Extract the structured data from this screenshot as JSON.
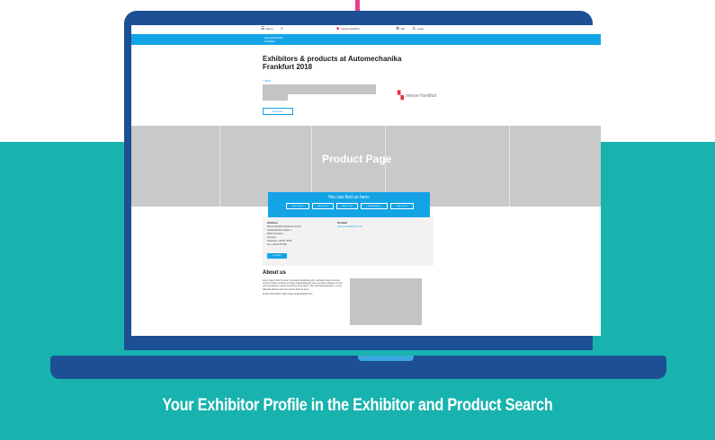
{
  "colors": {
    "teal": "#18b3ae",
    "laptop_blue": "#1d4f95",
    "site_blue": "#14a4e6",
    "placeholder_gray": "#c4c4c4",
    "logo_red": "#e5303f",
    "cord_pink": "#e83c8e"
  },
  "topbar": {
    "menu_label": "Menu",
    "search_icon": "search-icon",
    "center_text": "messe frankfurt",
    "lang_label": "EN",
    "login_label": "Login"
  },
  "brandbar": {
    "line1": "automechanika",
    "line2": "Frankfurt"
  },
  "page": {
    "title": "Exhibitors & products at Automechanika Frankfurt 2018",
    "breadcrumb": "< Back",
    "logo_text": "messe frankfurt",
    "outline_button": "Bookmark"
  },
  "gallery": {
    "caption": "Product Page"
  },
  "findus": {
    "title": "You can find us here:",
    "halls": [
      "HALL 3.0 B1",
      "HALL 4.0 B2",
      "HALL 5.0 B3",
      "FREE-AREA F2",
      "HALL 9.0 B4"
    ]
  },
  "contact": {
    "address_label": "Address",
    "lines": [
      "Messe Frankfurt Exhibition GmbH",
      "Ludwig-Erhard-Anlage 1",
      "60327 Frankfurt",
      "Germany",
      "Telephone +49 69 75750",
      "Fax +49 69 757568"
    ],
    "contact_label": "Contact",
    "website": "www.messefrankfurt.com",
    "button": "CONTACT"
  },
  "about": {
    "heading": "About us",
    "text": "Lorem ipsum dolor sit amet, consetetur sadipscing elitr, sed diam nonumy eirmod tempor invidunt ut labore et dolore magna aliquyam erat, sed diam voluptua. At vero eos et accusam et justo duo dolores et ea rebum. Stet clita kasd gubergren, no sea takimata sanctus est Lorem ipsum dolor sit amet.",
    "more": "Further information: https://www.messefrankfurt.com"
  },
  "caption": "Your Exhibitor Profile in the Exhibitor and Product Search"
}
